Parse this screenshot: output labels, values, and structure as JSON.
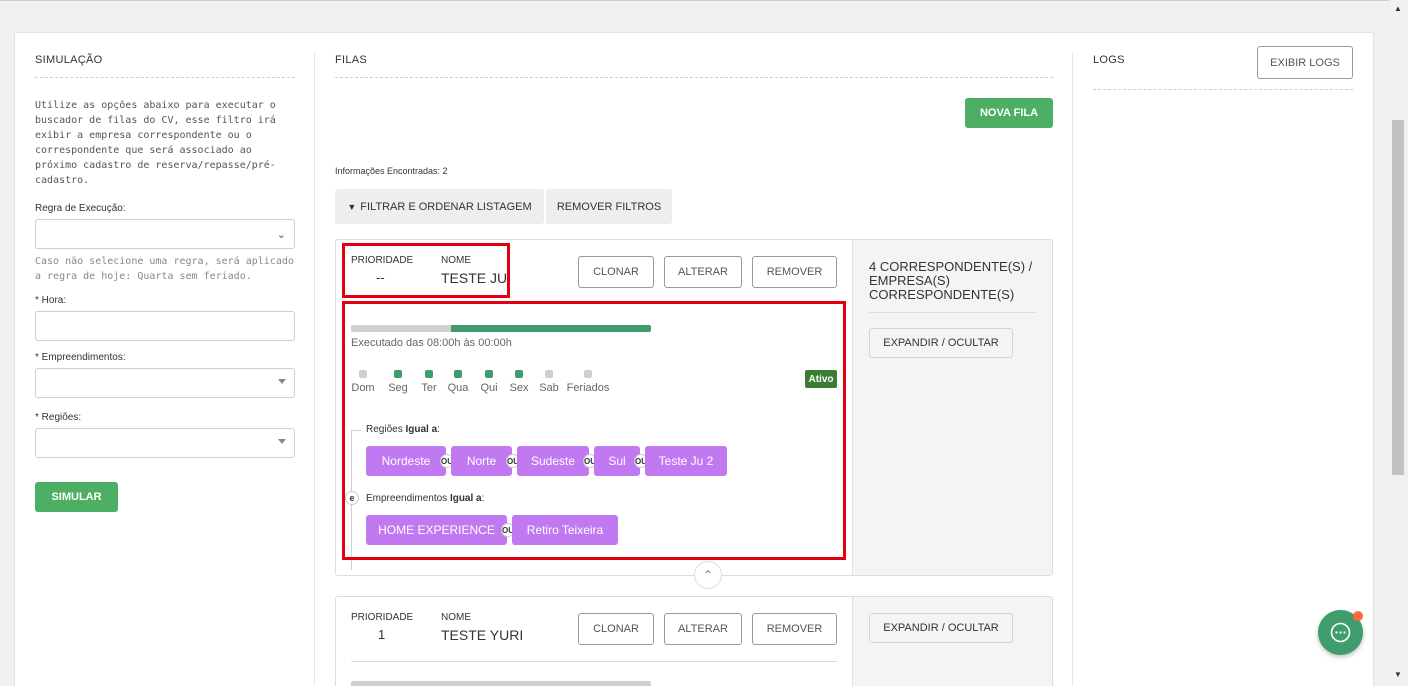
{
  "simulacao": {
    "title": "SIMULAÇÃO",
    "description": "Utilize as opções abaixo para executar o buscador de filas do CV, esse filtro irá exibir a empresa correspondente ou o correspondente que será associado ao próximo cadastro de reserva/repasse/pré-cadastro.",
    "regra_label": "Regra de Execução:",
    "regra_hint": "Caso não selecione uma regra, será aplicado a regra de hoje: Quarta sem feriado.",
    "hora_label": "* Hora:",
    "empreendimentos_label": "* Empreendimentos:",
    "regioes_label": "* Regiões:",
    "simular_button": "SIMULAR"
  },
  "filas": {
    "title": "FILAS",
    "nova_fila_button": "NOVA FILA",
    "info_found": "Informações Encontradas: 2",
    "filter_button": "FILTRAR E ORDENAR LISTAGEM",
    "remove_filters_button": "REMOVER FILTROS",
    "queues": [
      {
        "prioridade_label": "PRIORIDADE",
        "prioridade": "--",
        "nome_label": "NOME",
        "nome": "TESTE JU",
        "clonar": "CLONAR",
        "alterar": "ALTERAR",
        "remover": "REMOVER",
        "correspondentes": "4 CORRESPONDENTE(S) / EMPRESA(S) CORRESPONDENTE(S)",
        "expandir": "EXPANDIR / OCULTAR",
        "executado": "Executado das 08:00h às 00:00h",
        "progress_gray_fraction": 0.333,
        "status": "Ativo",
        "days": [
          {
            "label": "Dom",
            "active": false
          },
          {
            "label": "Seg",
            "active": true
          },
          {
            "label": "Ter",
            "active": true
          },
          {
            "label": "Qua",
            "active": true
          },
          {
            "label": "Qui",
            "active": true
          },
          {
            "label": "Sex",
            "active": true
          },
          {
            "label": "Sab",
            "active": false
          },
          {
            "label": "Feriados",
            "active": false
          }
        ],
        "regioes_cond_prefix": "Regiões ",
        "regioes_cond_op": "Igual a",
        "regioes_cond_suffix": ":",
        "regioes": [
          "Nordeste",
          "Norte",
          "Sudeste",
          "Sul",
          "Teste Ju 2"
        ],
        "ou_label": "OU",
        "e_label": "e",
        "emp_cond_prefix": "Empreendimentos ",
        "emp_cond_op": "Igual a",
        "emp_cond_suffix": ":",
        "empreendimentos": [
          "HOME EXPERIENCE",
          "Retiro Teixeira"
        ]
      },
      {
        "prioridade_label": "PRIORIDADE",
        "prioridade": "1",
        "nome_label": "NOME",
        "nome": "TESTE YURI",
        "clonar": "CLONAR",
        "alterar": "ALTERAR",
        "remover": "REMOVER",
        "expandir": "EXPANDIR / OCULTAR"
      }
    ]
  },
  "logs": {
    "title": "LOGS",
    "exibir_logs_button": "EXIBIR LOGS"
  },
  "colors": {
    "green": "#4caf63",
    "dark_green": "#3f9d6d",
    "tag_purple": "#c179f2",
    "highlight_red": "#e0000f"
  }
}
